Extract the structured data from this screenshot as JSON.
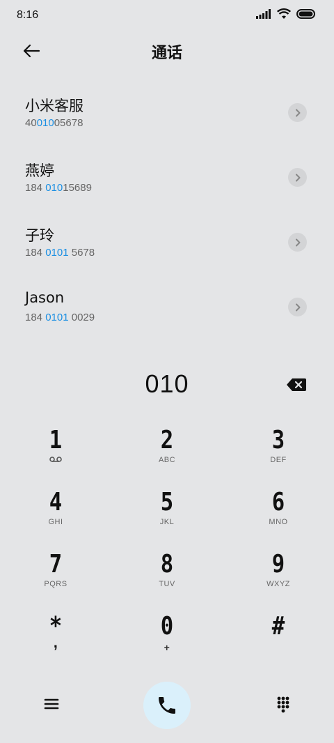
{
  "status_bar": {
    "time": "8:16"
  },
  "header": {
    "title": "通话"
  },
  "results": [
    {
      "name": "小米客服",
      "number_pre": "40",
      "number_match": "010",
      "number_post": "05678"
    },
    {
      "name": "燕婷",
      "number_pre": "184 ",
      "number_match": "010",
      "number_post": "15689"
    },
    {
      "name": "子玲",
      "number_pre": "184 ",
      "number_match": "0101",
      "number_post": " 5678"
    },
    {
      "name": "Jason",
      "number_pre": "184 ",
      "number_match": "0101",
      "number_post": " 0029"
    }
  ],
  "dialer": {
    "entered_number": "010"
  },
  "keypad": [
    {
      "digit": "1",
      "letters": ""
    },
    {
      "digit": "2",
      "letters": "ABC"
    },
    {
      "digit": "3",
      "letters": "DEF"
    },
    {
      "digit": "4",
      "letters": "GHI"
    },
    {
      "digit": "5",
      "letters": "JKL"
    },
    {
      "digit": "6",
      "letters": "MNO"
    },
    {
      "digit": "7",
      "letters": "PQRS"
    },
    {
      "digit": "8",
      "letters": "TUV"
    },
    {
      "digit": "9",
      "letters": "WXYZ"
    },
    {
      "digit": "*",
      "letters": ","
    },
    {
      "digit": "0",
      "letters": "+"
    },
    {
      "digit": "#",
      "letters": ""
    }
  ],
  "colors": {
    "background": "#e4e5e7",
    "match_highlight": "#1a8fe3",
    "call_button": "#daf0fb"
  },
  "icons": [
    "signal-icon",
    "wifi-icon",
    "battery-icon",
    "back-arrow-icon",
    "chevron-right-icon",
    "backspace-icon",
    "voicemail-icon",
    "menu-icon",
    "phone-icon",
    "dialpad-icon"
  ]
}
